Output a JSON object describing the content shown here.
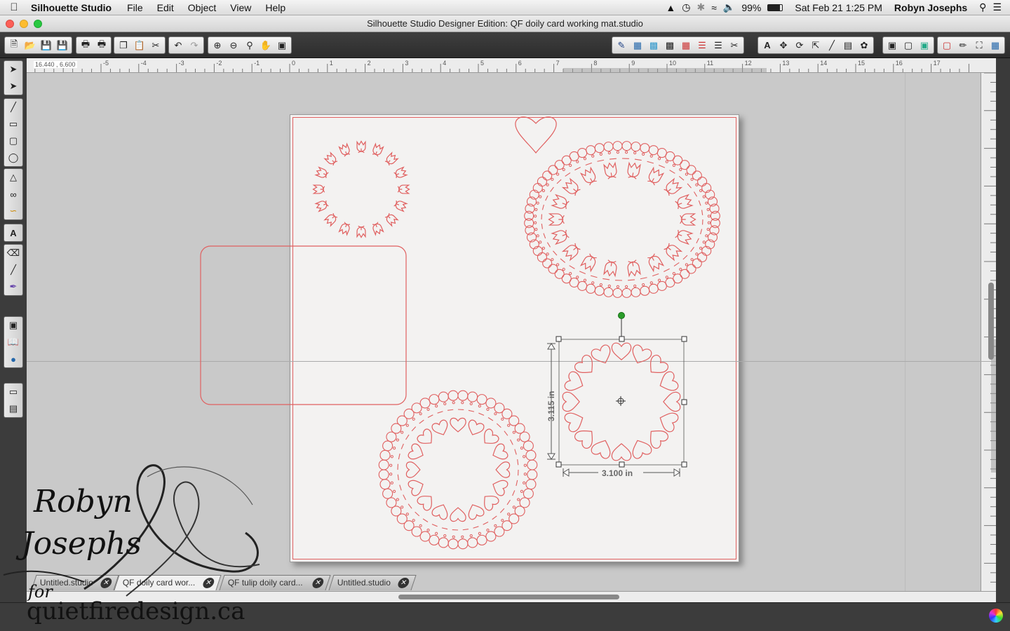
{
  "menubar": {
    "app_name": "Silhouette Studio",
    "menus": [
      "File",
      "Edit",
      "Object",
      "View",
      "Help"
    ],
    "battery": "99%",
    "datetime": "Sat Feb 21  1:25 PM",
    "user": "Robyn Josephs"
  },
  "window": {
    "title": "Silhouette Studio Designer Edition: QF doily card working mat.studio"
  },
  "ruler": {
    "coordinates": "16.440 , 6.600",
    "ticks": [
      "-5",
      "-4",
      "-3",
      "-2",
      "-1",
      "0",
      "1",
      "2",
      "3",
      "4",
      "5",
      "6",
      "7",
      "8",
      "9",
      "10",
      "11",
      "12",
      "13",
      "14",
      "15",
      "16",
      "17"
    ]
  },
  "selection": {
    "height_label": "3.115 in",
    "width_label": "3.100 in"
  },
  "tabs": [
    {
      "label": "Untitled.studio",
      "active": false
    },
    {
      "label": "QF doily card wor...",
      "active": true
    },
    {
      "label": "QF tulip doily card...",
      "active": false
    },
    {
      "label": "Untitled.studio",
      "active": false
    }
  ],
  "watermark": {
    "line1": "Robyn",
    "line2": "Josephs",
    "line3": "for",
    "line4": "quietfiredesign.ca"
  },
  "colors": {
    "cut_line": "#e06060",
    "canvas": "#c9c9c9",
    "page": "#f3f2f1",
    "rotate_handle": "#2a9d2a"
  }
}
